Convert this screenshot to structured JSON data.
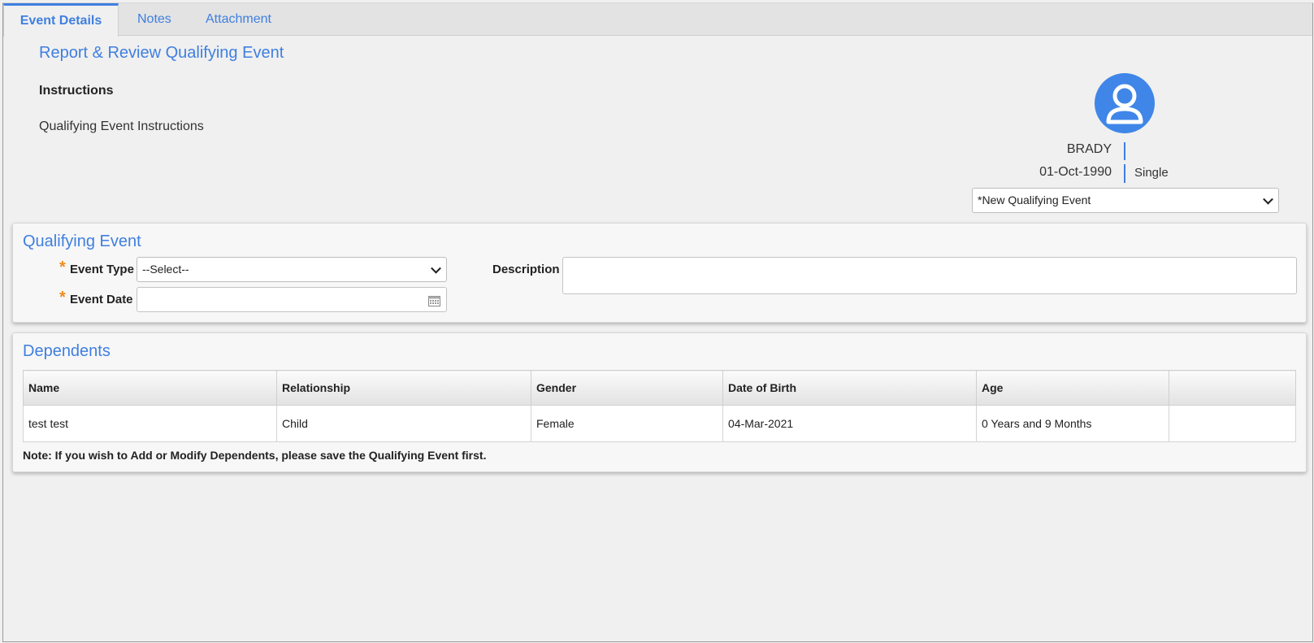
{
  "tabs": [
    {
      "label": "Event Details",
      "active": true
    },
    {
      "label": "Notes",
      "active": false
    },
    {
      "label": "Attachment",
      "active": false
    }
  ],
  "page": {
    "title": "Report & Review Qualifying Event",
    "instructions_heading": "Instructions",
    "instructions_text": "Qualifying Event Instructions"
  },
  "profile": {
    "avatar_icon": "user-avatar-icon",
    "name": "BRADY",
    "dob": "01-Oct-1990",
    "marital_status": "Single",
    "event_select_value": "*New Qualifying Event"
  },
  "qualifying_event": {
    "title": "Qualifying Event",
    "event_type_label": "Event Type",
    "event_type_value": "--Select--",
    "event_date_label": "Event Date",
    "event_date_value": "",
    "description_label": "Description",
    "description_value": "",
    "required_marker": "*"
  },
  "dependents": {
    "title": "Dependents",
    "columns": [
      "Name",
      "Relationship",
      "Gender",
      "Date of Birth",
      "Age",
      ""
    ],
    "rows": [
      [
        "test test",
        "Child",
        "Female",
        "04-Mar-2021",
        "0 Years and 9 Months",
        ""
      ]
    ],
    "note": "Note: If you wish to Add or Modify Dependents, please save the Qualifying Event first."
  },
  "colors": {
    "accent": "#3f7fe0",
    "required": "#f08c1e",
    "avatar": "#3f86e8"
  }
}
